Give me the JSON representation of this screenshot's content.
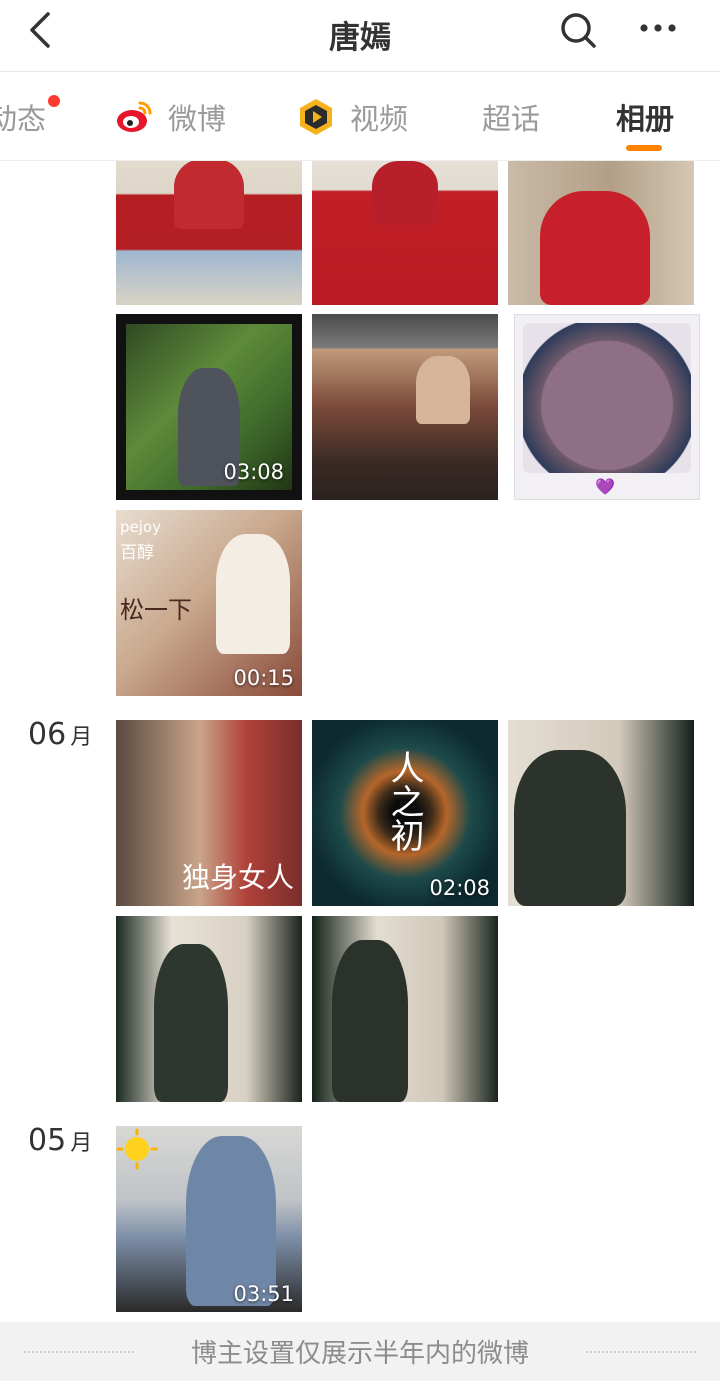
{
  "header": {
    "title": "唐嫣"
  },
  "tabs": [
    {
      "label": "动态",
      "has_dot": true
    },
    {
      "label": "微博"
    },
    {
      "label": "视频"
    },
    {
      "label": "超话"
    },
    {
      "label": "相册",
      "active": true
    }
  ],
  "colors": {
    "accent": "#ff8200",
    "notification_dot": "#ff3b30",
    "inactive_tab": "#9a9a9a",
    "active_tab": "#333333"
  },
  "album": {
    "months": [
      {
        "label": "06",
        "unit": "月"
      },
      {
        "label": "05",
        "unit": "月"
      }
    ],
    "durations": {
      "green_video": "03:08",
      "tea_video": "00:15",
      "swirl_video": "02:08",
      "sun_video": "03:51"
    },
    "thumb_texts": {
      "tea_brand": "pejoy",
      "tea_brand_cn": "百醇",
      "tea_slogan": "松一下",
      "poster_title": "独身女人",
      "swirl_title": "人之初"
    },
    "cake_emoji": "💜"
  },
  "footer": {
    "notice": "博主设置仅展示半年内的微博"
  }
}
